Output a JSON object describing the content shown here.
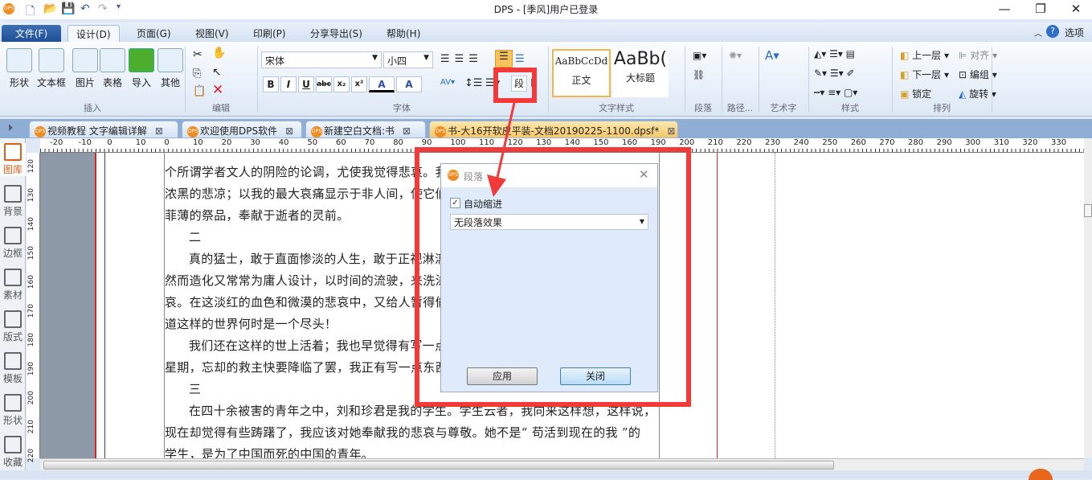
{
  "window": {
    "title": "DPS - [季风]用户已登录",
    "min": "—",
    "restore": "❐",
    "close": "✕"
  },
  "quick_access": [
    "new-file",
    "open",
    "save",
    "undo",
    "redo",
    "customize"
  ],
  "menu": {
    "tabs": [
      "文件(F)",
      "设计(D)",
      "页面(G)",
      "视图(V)",
      "印刷(P)",
      "分享导出(S)",
      "帮助(H)"
    ],
    "options": "选项"
  },
  "ribbon": {
    "insert": {
      "label": "插入",
      "buttons": [
        "形状",
        "文本框",
        "图片",
        "表格",
        "导入",
        "其他"
      ]
    },
    "edit": {
      "label": "编辑"
    },
    "font": {
      "label": "字体",
      "font_name": "宋体",
      "font_size": "小四",
      "format_buttons": [
        "B",
        "I",
        "U",
        "abc",
        "x₂",
        "x²",
        "A",
        "A"
      ],
      "para_button": "段"
    },
    "text_style": {
      "label": "文字样式",
      "styles": [
        {
          "preview": "AaBbCcDd",
          "name": "正文"
        },
        {
          "preview": "AaBb(",
          "name": "大标题"
        }
      ]
    },
    "paragraph": {
      "label": "段落"
    },
    "path": {
      "label": "路径..."
    },
    "art": {
      "label": "艺术字"
    },
    "style": {
      "label": "样式"
    },
    "arrange": {
      "label": "排列",
      "buttons": [
        "上一层",
        "下一层",
        "锁定",
        "对齐",
        "编组",
        "旋转"
      ]
    }
  },
  "doc_tabs": [
    {
      "title": "视频教程 文字编辑详解",
      "active": false
    },
    {
      "title": "欢迎使用DPS软件",
      "active": false
    },
    {
      "title": "新建空白文档:书",
      "active": false
    },
    {
      "title": "书-大16开软皮平装-文档20190225-1100.dpsf*",
      "active": true
    }
  ],
  "sidebar": [
    "图库",
    "背景",
    "边框",
    "素材",
    "版式",
    "模板",
    "形状",
    "收藏"
  ],
  "ruler": {
    "h": [
      "-20",
      "-10",
      "0",
      "10",
      "0",
      "10",
      "20",
      "30",
      "40",
      "50",
      "60",
      "70",
      "80",
      "90",
      "100",
      "110",
      "120",
      "130",
      "140",
      "150",
      "160",
      "190",
      "200",
      "210",
      "220",
      "230",
      "240",
      "250",
      "260",
      "270",
      "280",
      "290",
      "300",
      "310",
      "320",
      "330"
    ],
    "v": [
      "120",
      "130",
      "140",
      "150",
      "160",
      "170",
      "180",
      "190",
      "200",
      "210",
      "220"
    ]
  },
  "document": {
    "lines": [
      {
        "text": "个所谓学者文人的阴险的论调，尤使我觉得悲哀。我",
        "indent": false
      },
      {
        "text": "浓黑的悲凉；以我的最大哀痛显示于非人间，使它们",
        "indent": false
      },
      {
        "text": "菲薄的祭品，奉献于逝者的灵前。",
        "indent": false
      },
      {
        "text": "二",
        "indent": true
      },
      {
        "text": "真的猛士，敢于直面惨淡的人生，敢于正视淋漓",
        "indent": true
      },
      {
        "text": "然而造化又常常为庸人设计，以时间的流驶，来洗涤",
        "indent": false
      },
      {
        "text": "哀。在这淡红的血色和微漠的悲哀中，又给人暂得偷",
        "indent": false
      },
      {
        "text": "道这样的世界何时是一个尽头！",
        "indent": false
      },
      {
        "text": "我们还在这样的世上活着；我也早觉得有写一点",
        "indent": true
      },
      {
        "text": "星期，忘却的救主快要降临了罢，我正有写一点东西",
        "indent": false
      },
      {
        "text": "三",
        "indent": true
      },
      {
        "text": "在四十余被害的青年之中，刘和珍君是我的学生。学生云者，我向来这样想，这样说，",
        "indent": true
      },
      {
        "text": "现在却觉得有些踌躇了，我应该对她奉献我的悲哀与尊敬。她不是“ 苟活到现在的我 ”的",
        "indent": false
      },
      {
        "text": "学生，是为了中国而死的中国的青年。",
        "indent": false
      }
    ]
  },
  "dialog": {
    "title": "段落",
    "auto_indent_label": "自动缩进",
    "auto_indent_checked": true,
    "effect_value": "无段落效果",
    "apply": "应用",
    "close": "关闭"
  },
  "annotation_color": "#f23a3a"
}
